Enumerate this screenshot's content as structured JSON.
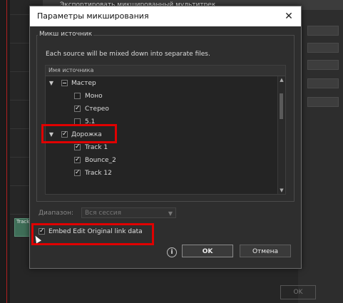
{
  "background": {
    "window_title": "Экспортировать микшированный мультитрек",
    "clip_label": "Track",
    "ok_label": "OK"
  },
  "dialog": {
    "title": "Параметры микширования",
    "close_glyph": "✕",
    "source_group_label": "Микш источник",
    "description": "Each source will be mixed down into separate files.",
    "tree_header": "Имя источника",
    "tree_items": [
      {
        "label": "Мастер",
        "state": "partial",
        "expanded": true
      },
      {
        "label": "Моно",
        "checked": false
      },
      {
        "label": "Стерео",
        "checked": true
      },
      {
        "label": "5.1",
        "checked": false
      },
      {
        "label": "Дорожка",
        "checked": true,
        "expanded": true
      },
      {
        "label": "Track 1",
        "checked": true
      },
      {
        "label": "Bounce_2",
        "checked": true
      },
      {
        "label": "Track 12",
        "checked": true
      }
    ],
    "range_label": "Диапазон:",
    "range_value": "Вся сессия",
    "embed_label": "Embed Edit Original link data",
    "embed_checked": true,
    "ok_label": "OK",
    "cancel_label": "Отмена"
  },
  "colors": {
    "highlight": "#e00000",
    "dialog_bg": "#2e2e2e"
  }
}
